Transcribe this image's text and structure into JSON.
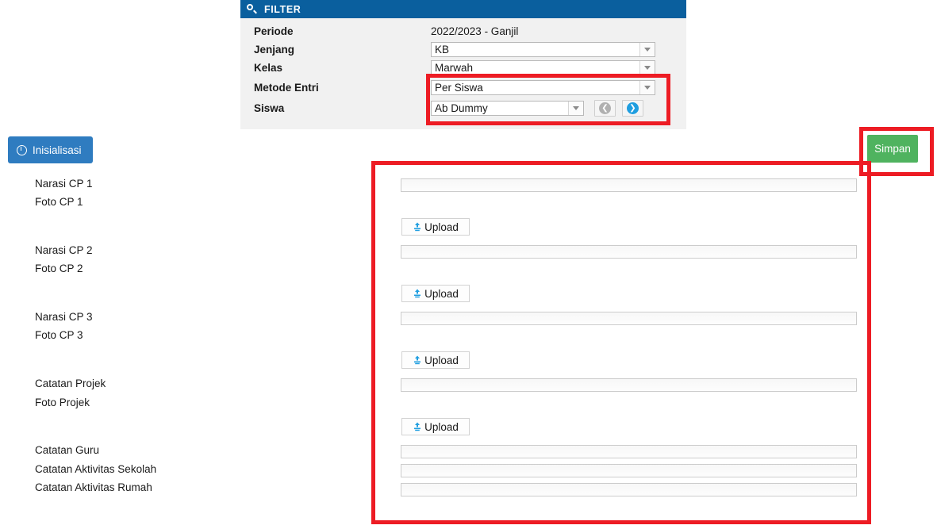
{
  "filter": {
    "header_title": "FILTER",
    "header_icon": "search-icon",
    "rows": [
      {
        "label": "Periode",
        "type": "text",
        "value": "2022/2023 - Ganjil"
      },
      {
        "label": "Jenjang",
        "type": "dropdown",
        "value": "KB"
      },
      {
        "label": "Kelas",
        "type": "dropdown",
        "value": "Marwah"
      },
      {
        "label": "Metode Entri",
        "type": "dropdown",
        "value": "Per Siswa"
      },
      {
        "label": "Siswa",
        "type": "dropdown-nav",
        "value": "Ab Dummy"
      }
    ],
    "nav": {
      "prev_icon": "chevron-left-circle-icon",
      "prev_glyph": "❮",
      "prev_state": "disabled",
      "next_icon": "chevron-right-circle-icon",
      "next_glyph": "❯",
      "next_state": "enabled"
    }
  },
  "toolbar": {
    "inisialisasi_label": "Inisialisasi",
    "inisialisasi_icon": "clock-icon",
    "simpan_label": "Simpan"
  },
  "form": {
    "upload_label": "Upload",
    "upload_icon": "upload-icon",
    "rows": [
      {
        "label": "Narasi CP 1",
        "kind": "text",
        "value": ""
      },
      {
        "label": "Foto CP 1",
        "kind": "upload",
        "value": ""
      },
      {
        "label": "Narasi CP 2",
        "kind": "text",
        "value": ""
      },
      {
        "label": "Foto CP 2",
        "kind": "upload",
        "value": ""
      },
      {
        "label": "Narasi CP 3",
        "kind": "text",
        "value": ""
      },
      {
        "label": "Foto CP 3",
        "kind": "upload",
        "value": ""
      },
      {
        "label": "Catatan Projek",
        "kind": "text",
        "value": ""
      },
      {
        "label": "Foto Projek",
        "kind": "upload",
        "value": ""
      },
      {
        "label": "Catatan Guru",
        "kind": "text",
        "value": ""
      },
      {
        "label": "Catatan Aktivitas Sekolah",
        "kind": "text",
        "value": ""
      },
      {
        "label": "Catatan Aktivitas Rumah",
        "kind": "text",
        "value": ""
      }
    ]
  },
  "annotations": {
    "box_color": "#ed1c24",
    "boxes": [
      {
        "name": "filter-entry-highlight"
      },
      {
        "name": "simpan-highlight"
      },
      {
        "name": "form-fields-highlight"
      }
    ]
  },
  "colors": {
    "header_blue": "#0a5f9e",
    "button_blue": "#2f7cc0",
    "save_green": "#4fb35f",
    "panel_gray": "#f1f1f1",
    "annotation_red": "#ed1c24",
    "next_icon_blue": "#1f9ee0"
  }
}
